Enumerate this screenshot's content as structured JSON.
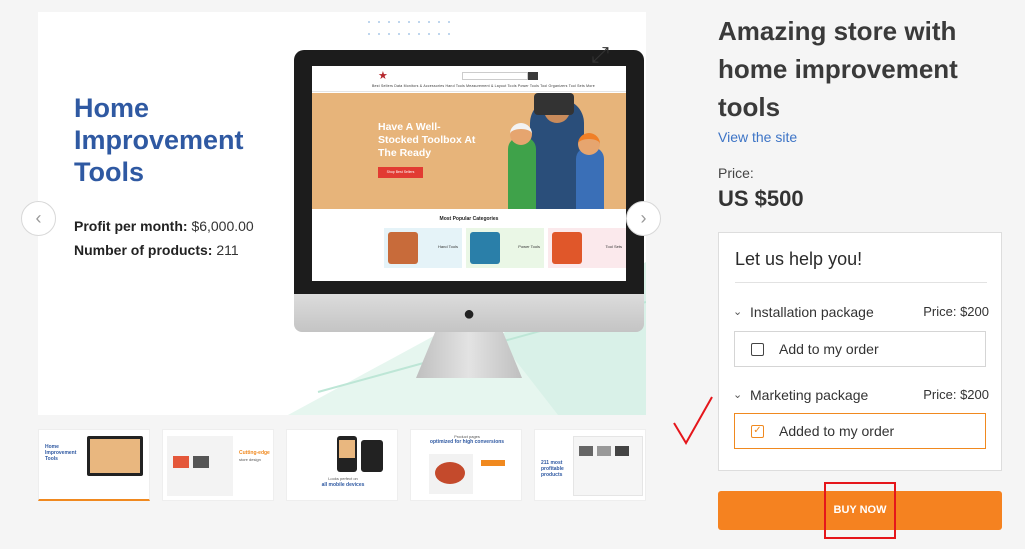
{
  "gallery": {
    "hero_title": "Home Improvement Tools",
    "stats": [
      {
        "label": "Profit per month:",
        "value": "$6,000.00"
      },
      {
        "label": "Number of products:",
        "value": "211"
      }
    ],
    "screen": {
      "nav": "Best Sellers    Data Monitors & Accessories    Hand Tools    Measurement & Layout Tools    Power Tools    Tool Organizers    Tool Sets    More",
      "banner_text": "Have A Well-Stocked Toolbox At The Ready",
      "banner_button": "Shop Best Sellers",
      "categories_title": "Most Popular Categories",
      "categories": [
        "Hand Tools",
        "Power Tools",
        "Tool Sets"
      ]
    },
    "thumbnails": [
      {
        "title": "Home Improvement Tools",
        "caption": ""
      },
      {
        "title": "Cutting-edge",
        "caption": "store design"
      },
      {
        "title": "Looks perfect on",
        "caption": "all mobile devices"
      },
      {
        "title": "optimized for high conversions",
        "caption": "Product pages"
      },
      {
        "title": "211 most profitable products",
        "caption": ""
      }
    ]
  },
  "product": {
    "title": "Amazing store with home improvement tools",
    "view_site": "View the site",
    "price_label": "Price:",
    "price_value": "US $500"
  },
  "help": {
    "title": "Let us help you!",
    "packages": [
      {
        "name": "Installation package",
        "price_label": "Price:",
        "price": "$200",
        "order_label": "Add to my order",
        "checked": false
      },
      {
        "name": "Marketing package",
        "price_label": "Price:",
        "price": "$200",
        "order_label": "Added to my order",
        "checked": true
      }
    ]
  },
  "buy_button": "BUY NOW",
  "colors": {
    "accent": "#f58220",
    "title_blue": "#2f59a2",
    "link": "#3d74c6",
    "annotation": "#e5161b"
  }
}
